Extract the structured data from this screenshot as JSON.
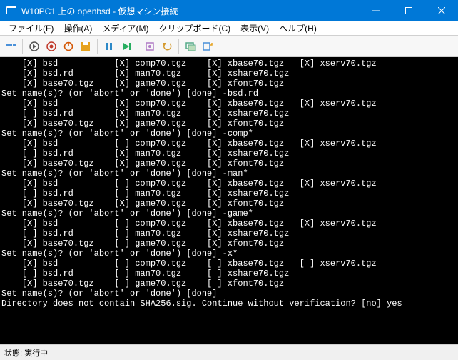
{
  "titlebar": {
    "text": "W10PC1 上の openbsd - 仮想マシン接続"
  },
  "menubar": {
    "file": "ファイル(F)",
    "action": "操作(A)",
    "media": "メディア(M)",
    "clip": "クリップボード(C)",
    "view": "表示(V)",
    "help": "ヘルプ(H)"
  },
  "toolbar_icons": {
    "cad": "cad-icon",
    "start": "start-icon",
    "off": "off-icon",
    "shutdown": "shutdown-icon",
    "save": "save-icon",
    "pause": "pause-icon",
    "reset": "reset-icon",
    "checkpoint": "checkpoint-icon",
    "revert": "revert-icon",
    "enhanced": "enhanced-icon",
    "share": "share-icon"
  },
  "statusbar": {
    "label": "状態:",
    "value": "実行中"
  },
  "terminal_lines": [
    "    [X] bsd           [X] comp70.tgz    [X] xbase70.tgz   [X] xserv70.tgz",
    "    [X] bsd.rd        [X] man70.tgz     [X] xshare70.tgz",
    "    [X] base70.tgz    [X] game70.tgz    [X] xfont70.tgz",
    "Set name(s)? (or 'abort' or 'done') [done] -bsd.rd",
    "    [X] bsd           [X] comp70.tgz    [X] xbase70.tgz   [X] xserv70.tgz",
    "    [ ] bsd.rd        [X] man70.tgz     [X] xshare70.tgz",
    "    [X] base70.tgz    [X] game70.tgz    [X] xfont70.tgz",
    "Set name(s)? (or 'abort' or 'done') [done] -comp*",
    "    [X] bsd           [ ] comp70.tgz    [X] xbase70.tgz   [X] xserv70.tgz",
    "    [ ] bsd.rd        [X] man70.tgz     [X] xshare70.tgz",
    "    [X] base70.tgz    [X] game70.tgz    [X] xfont70.tgz",
    "Set name(s)? (or 'abort' or 'done') [done] -man*",
    "    [X] bsd           [ ] comp70.tgz    [X] xbase70.tgz   [X] xserv70.tgz",
    "    [ ] bsd.rd        [ ] man70.tgz     [X] xshare70.tgz",
    "    [X] base70.tgz    [X] game70.tgz    [X] xfont70.tgz",
    "Set name(s)? (or 'abort' or 'done') [done] -game*",
    "    [X] bsd           [ ] comp70.tgz    [X] xbase70.tgz   [X] xserv70.tgz",
    "    [ ] bsd.rd        [ ] man70.tgz     [X] xshare70.tgz",
    "    [X] base70.tgz    [ ] game70.tgz    [X] xfont70.tgz",
    "Set name(s)? (or 'abort' or 'done') [done] -x*",
    "    [X] bsd           [ ] comp70.tgz    [ ] xbase70.tgz   [ ] xserv70.tgz",
    "    [ ] bsd.rd        [ ] man70.tgz     [ ] xshare70.tgz",
    "    [X] base70.tgz    [ ] game70.tgz    [ ] xfont70.tgz",
    "Set name(s)? (or 'abort' or 'done') [done]",
    "Directory does not contain SHA256.sig. Continue without verification? [no] yes"
  ]
}
